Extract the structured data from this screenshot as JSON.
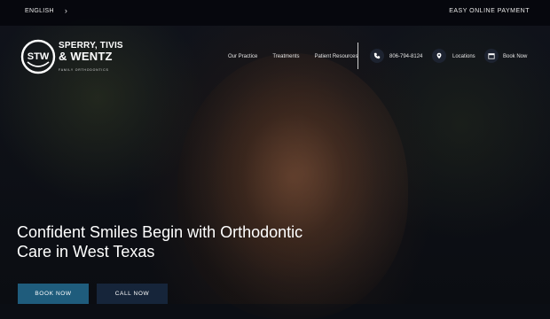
{
  "topbar": {
    "language": "ENGLISH",
    "payment_link": "EASY ONLINE PAYMENT"
  },
  "logo": {
    "monogram": "STW",
    "line1": "SPERRY, TIVIS",
    "line2": "& WENTZ",
    "tagline": "FAMILY ORTHODONTICS"
  },
  "nav": {
    "items": [
      "Our Practice",
      "Treatments",
      "Patient Resources"
    ]
  },
  "utility": {
    "phone": "806-794-8124",
    "locations": "Locations",
    "book": "Book Now"
  },
  "hero": {
    "headline_line1": "Confident Smiles Begin with Orthodontic",
    "headline_line2": "Care in West Texas"
  },
  "cta": {
    "book_label": "BOOK NOW",
    "call_label": "CALL NOW"
  },
  "colors": {
    "book_button": "#1f5c7c",
    "call_button": "#16253a",
    "topbar": "#05070c"
  }
}
